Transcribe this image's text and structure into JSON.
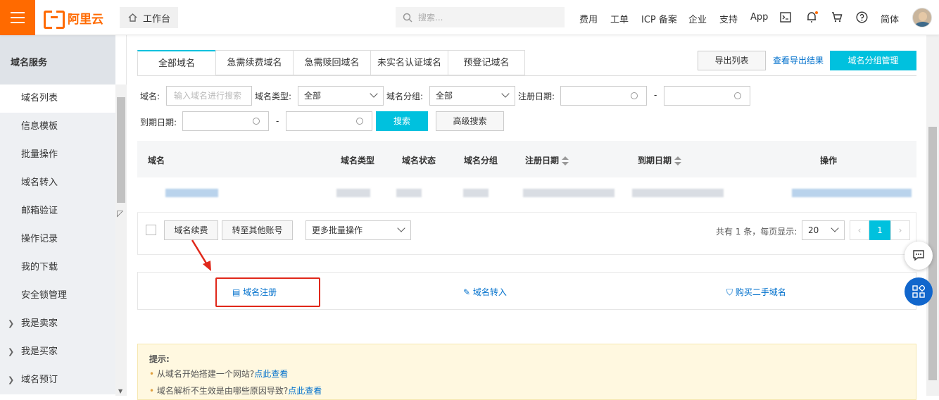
{
  "topbar": {
    "logo_text": "阿里云",
    "workbench": "工作台",
    "search_placeholder": "搜索...",
    "nav": [
      "费用",
      "工单",
      "ICP 备案",
      "企业",
      "支持",
      "App"
    ],
    "language": "简体"
  },
  "sidebar": {
    "title": "域名服务",
    "items": [
      {
        "label": "域名列表",
        "active": true,
        "expandable": false
      },
      {
        "label": "信息模板",
        "expandable": false
      },
      {
        "label": "批量操作",
        "expandable": false
      },
      {
        "label": "域名转入",
        "expandable": false
      },
      {
        "label": "邮箱验证",
        "expandable": false
      },
      {
        "label": "操作记录",
        "expandable": false
      },
      {
        "label": "我的下载",
        "expandable": false
      },
      {
        "label": "安全锁管理",
        "expandable": false
      },
      {
        "label": "我是卖家",
        "expandable": true
      },
      {
        "label": "我是买家",
        "expandable": true
      },
      {
        "label": "域名预订",
        "expandable": true
      }
    ]
  },
  "tabs": [
    "全部域名",
    "急需续费域名",
    "急需赎回域名",
    "未实名认证域名",
    "预登记域名"
  ],
  "actions": {
    "export_list": "导出列表",
    "view_export": "查看导出结果",
    "group_manage": "域名分组管理"
  },
  "filters": {
    "domain_label": "域名:",
    "domain_placeholder": "输入域名进行搜索",
    "type_label": "域名类型:",
    "type_value": "全部",
    "group_label": "域名分组:",
    "group_value": "全部",
    "reg_date_label": "注册日期:",
    "expire_date_label": "到期日期:",
    "dash": "-",
    "search_btn": "搜索",
    "advanced_btn": "高级搜索"
  },
  "table": {
    "columns": [
      "域名",
      "域名类型",
      "域名状态",
      "域名分组",
      "注册日期",
      "到期日期",
      "操作"
    ]
  },
  "batch": {
    "renew": "域名续费",
    "transfer_account": "转至其他账号",
    "more": "更多批量操作",
    "summary": "共有 1 条，每页显示:",
    "page_size": "20",
    "page": "1"
  },
  "quick_links": {
    "register": "域名注册",
    "transfer_in": "域名转入",
    "buy_second_hand": "购买二手域名"
  },
  "tips": {
    "title": "提示:",
    "items": [
      {
        "text": "从域名开始搭建一个网站?",
        "link": "点此查看"
      },
      {
        "text": "域名解析不生效是由哪些原因导致?",
        "link": "点此查看"
      }
    ]
  },
  "colors": {
    "brand": "#ff6a00",
    "accent": "#00c1de",
    "link": "#0070cc",
    "highlight": "#e0281a"
  }
}
